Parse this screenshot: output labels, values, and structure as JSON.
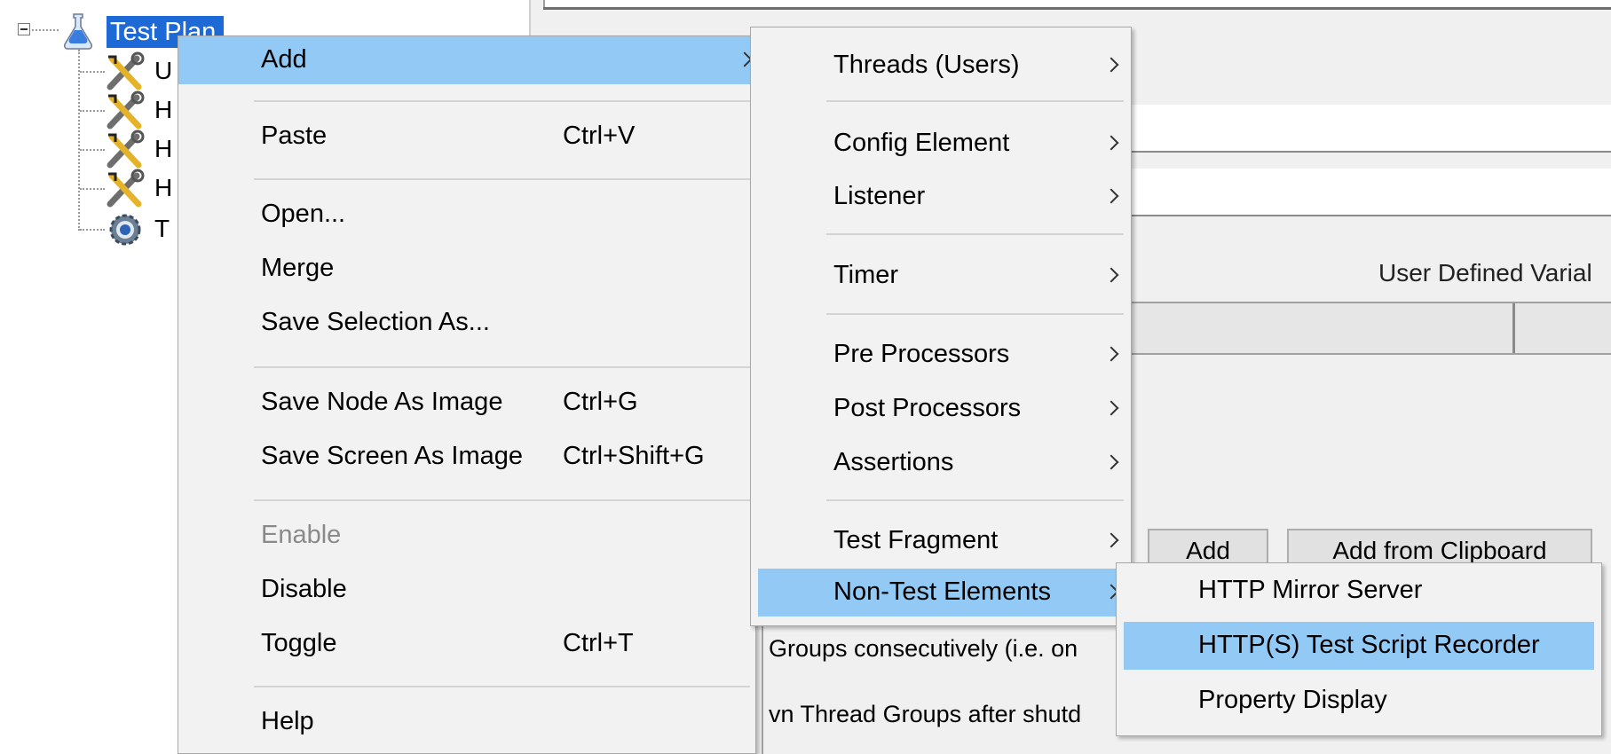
{
  "tree": {
    "root_label": "Test Plan",
    "children": [
      {
        "label": "U",
        "icon": "tools-icon"
      },
      {
        "label": "H",
        "icon": "tools-icon"
      },
      {
        "label": "H",
        "icon": "tools-icon"
      },
      {
        "label": "H",
        "icon": "tools-icon"
      },
      {
        "label": "T",
        "icon": "gear-icon"
      }
    ]
  },
  "editor": {
    "udv_title": "User Defined Varial",
    "add_button": "Add",
    "add_from_clipboard_button": "Add from Clipboard",
    "run_consecutive_text": "Groups consecutively (i.e. on",
    "run_teardown_text": "vn Thread Groups after shutd"
  },
  "context_menu": {
    "add": "Add",
    "paste": "Paste",
    "paste_shortcut": "Ctrl+V",
    "open": "Open...",
    "merge": "Merge",
    "save_selection_as": "Save Selection As...",
    "save_node_as_image": "Save Node As Image",
    "save_node_as_image_shortcut": "Ctrl+G",
    "save_screen_as_image": "Save Screen As Image",
    "save_screen_as_image_shortcut": "Ctrl+Shift+G",
    "enable": "Enable",
    "disable": "Disable",
    "toggle": "Toggle",
    "toggle_shortcut": "Ctrl+T",
    "help": "Help"
  },
  "add_menu": {
    "threads": "Threads (Users)",
    "config_element": "Config Element",
    "listener": "Listener",
    "timer": "Timer",
    "pre_processors": "Pre Processors",
    "post_processors": "Post Processors",
    "assertions": "Assertions",
    "test_fragment": "Test Fragment",
    "non_test_elements": "Non-Test Elements"
  },
  "non_test_menu": {
    "http_mirror_server": "HTTP Mirror Server",
    "http_test_script_recorder": "HTTP(S) Test Script Recorder",
    "property_display": "Property Display"
  },
  "colors": {
    "menu_highlight": "#92c9f5",
    "tree_selection": "#1d6ad6",
    "menu_background": "#f2f2f2"
  }
}
